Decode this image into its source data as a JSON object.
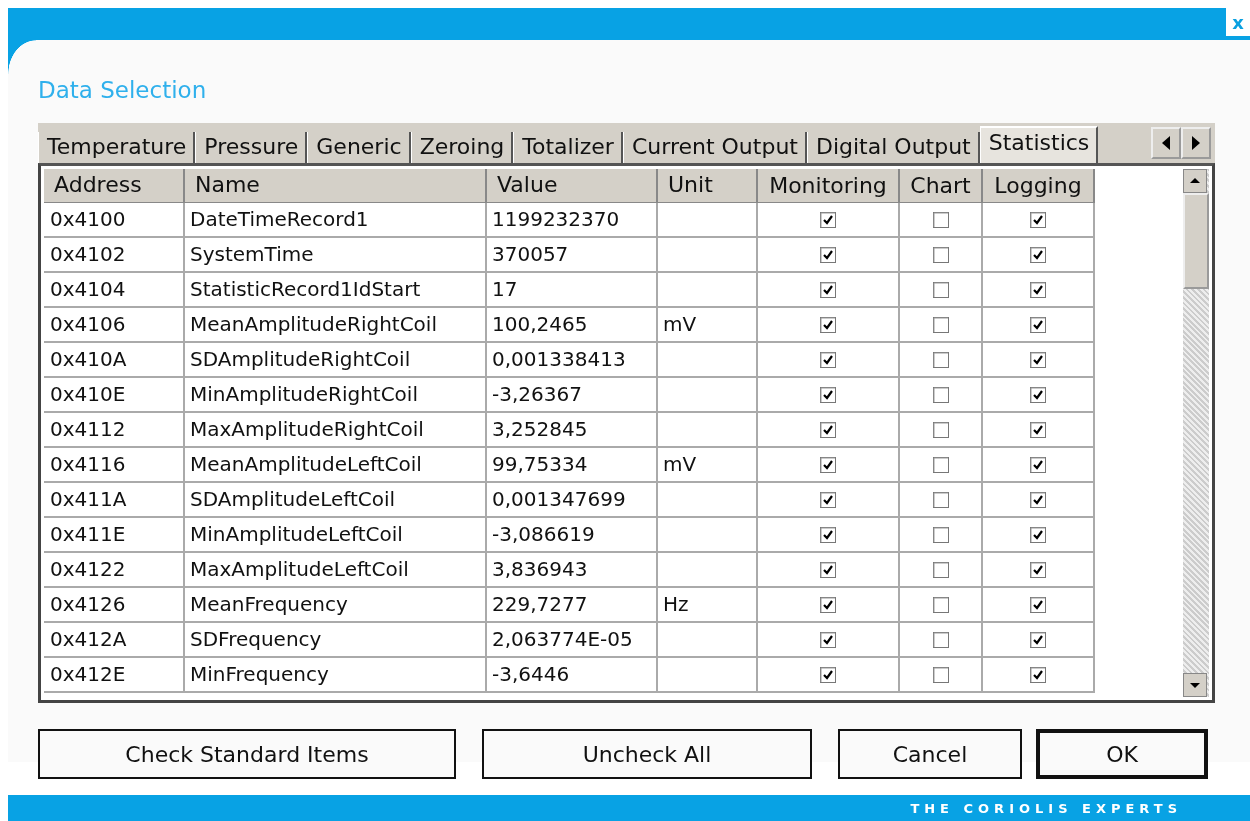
{
  "window": {
    "title": "Data Selection",
    "close": "x"
  },
  "tabs": [
    {
      "label": "Temperature",
      "selected": false
    },
    {
      "label": "Pressure",
      "selected": false
    },
    {
      "label": "Generic",
      "selected": false
    },
    {
      "label": "Zeroing",
      "selected": false
    },
    {
      "label": "Totalizer",
      "selected": false
    },
    {
      "label": "Current Output",
      "selected": false
    },
    {
      "label": "Digital Output",
      "selected": false
    },
    {
      "label": "Statistics",
      "selected": true
    }
  ],
  "table": {
    "columns": [
      "Address",
      "Name",
      "Value",
      "Unit",
      "Monitoring",
      "Chart",
      "Logging"
    ],
    "rows": [
      {
        "address": "0x4100",
        "name": "DateTimeRecord1",
        "value": "1199232370",
        "unit": "",
        "monitoring": true,
        "chart": false,
        "logging": true
      },
      {
        "address": "0x4102",
        "name": "SystemTime",
        "value": "370057",
        "unit": "",
        "monitoring": true,
        "chart": false,
        "logging": true
      },
      {
        "address": "0x4104",
        "name": "StatisticRecord1IdStart",
        "value": "17",
        "unit": "",
        "monitoring": true,
        "chart": false,
        "logging": true
      },
      {
        "address": "0x4106",
        "name": "MeanAmplitudeRightCoil",
        "value": "100,2465",
        "unit": "mV",
        "monitoring": true,
        "chart": false,
        "logging": true
      },
      {
        "address": "0x410A",
        "name": "SDAmplitudeRightCoil",
        "value": "0,001338413",
        "unit": "",
        "monitoring": true,
        "chart": false,
        "logging": true
      },
      {
        "address": "0x410E",
        "name": "MinAmplitudeRightCoil",
        "value": "-3,26367",
        "unit": "",
        "monitoring": true,
        "chart": false,
        "logging": true
      },
      {
        "address": "0x4112",
        "name": "MaxAmplitudeRightCoil",
        "value": "3,252845",
        "unit": "",
        "monitoring": true,
        "chart": false,
        "logging": true
      },
      {
        "address": "0x4116",
        "name": "MeanAmplitudeLeftCoil",
        "value": "99,75334",
        "unit": "mV",
        "monitoring": true,
        "chart": false,
        "logging": true
      },
      {
        "address": "0x411A",
        "name": "SDAmplitudeLeftCoil",
        "value": "0,001347699",
        "unit": "",
        "monitoring": true,
        "chart": false,
        "logging": true
      },
      {
        "address": "0x411E",
        "name": "MinAmplitudeLeftCoil",
        "value": "-3,086619",
        "unit": "",
        "monitoring": true,
        "chart": false,
        "logging": true
      },
      {
        "address": "0x4122",
        "name": "MaxAmplitudeLeftCoil",
        "value": "3,836943",
        "unit": "",
        "monitoring": true,
        "chart": false,
        "logging": true
      },
      {
        "address": "0x4126",
        "name": "MeanFrequency",
        "value": "229,7277",
        "unit": "Hz",
        "monitoring": true,
        "chart": false,
        "logging": true
      },
      {
        "address": "0x412A",
        "name": "SDFrequency",
        "value": "2,063774E-05",
        "unit": "",
        "monitoring": true,
        "chart": false,
        "logging": true
      },
      {
        "address": "0x412E",
        "name": "MinFrequency",
        "value": "-3,6446",
        "unit": "",
        "monitoring": true,
        "chart": false,
        "logging": true
      }
    ]
  },
  "buttons": [
    {
      "label": "Check Standard Items",
      "kind": "normal"
    },
    {
      "label": "Uncheck All",
      "kind": "normal"
    },
    {
      "label": "Cancel",
      "kind": "normal"
    },
    {
      "label": "OK",
      "kind": "default"
    }
  ],
  "footer": "THE CORIOLIS EXPERTS"
}
